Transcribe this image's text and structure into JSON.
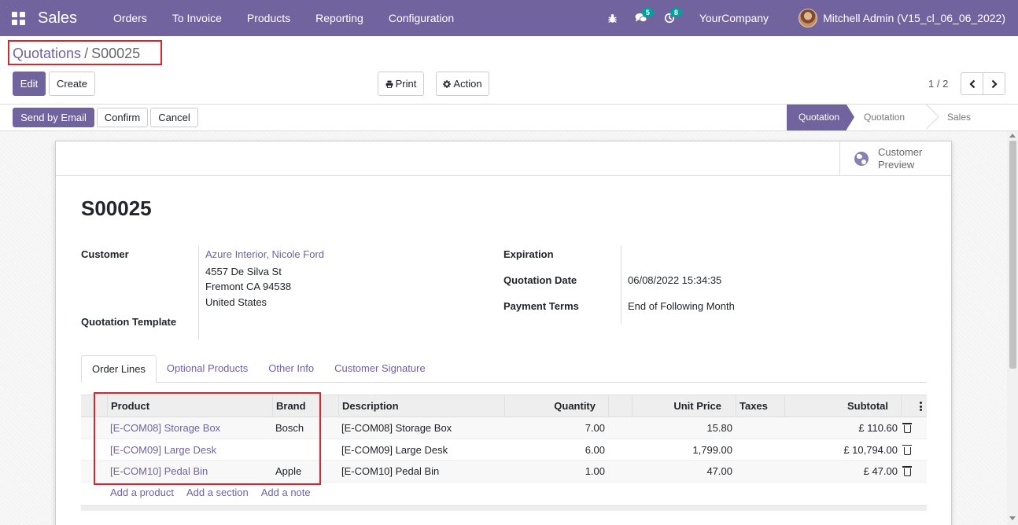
{
  "navbar": {
    "app_name": "Sales",
    "menu": [
      "Orders",
      "To Invoice",
      "Products",
      "Reporting",
      "Configuration"
    ],
    "messages_count": "5",
    "activities_count": "8",
    "company": "YourCompany",
    "user": "Mitchell Admin (V15_cl_06_06_2022)",
    "color": "#71639e"
  },
  "breadcrumb": {
    "parent": "Quotations",
    "separator": "/",
    "current": "S00025"
  },
  "control": {
    "edit": "Edit",
    "create": "Create",
    "print": "Print",
    "action": "Action",
    "pager": "1 / 2"
  },
  "statusbar": {
    "buttons": [
      "Send by Email",
      "Confirm",
      "Cancel"
    ],
    "steps": [
      "Quotation",
      "Quotation Sent",
      "Sales Order"
    ],
    "active_step": "Quotation"
  },
  "sheet": {
    "preview_label_1": "Customer",
    "preview_label_2": "Preview",
    "title": "S00025",
    "customer_label": "Customer",
    "customer_name": "Azure Interior, Nicole Ford",
    "address_1": "4557 De Silva St",
    "address_2": "Fremont CA 94538",
    "address_3": "United States",
    "template_label": "Quotation Template",
    "expiration_label": "Expiration",
    "quotation_date_label": "Quotation Date",
    "quotation_date": "06/08/2022 15:34:35",
    "payment_terms_label": "Payment Terms",
    "payment_terms": "End of Following Month"
  },
  "tabs": [
    "Order Lines",
    "Optional Products",
    "Other Info",
    "Customer Signature"
  ],
  "order_lines": {
    "headers": {
      "product": "Product",
      "brand": "Brand",
      "description": "Description",
      "quantity": "Quantity",
      "unit_price": "Unit Price",
      "taxes": "Taxes",
      "subtotal": "Subtotal"
    },
    "rows": [
      {
        "product": "[E-COM08] Storage Box",
        "brand": "Bosch",
        "description": "[E-COM08] Storage Box",
        "quantity": "7.00",
        "unit_price": "15.80",
        "subtotal": "£ 110.60"
      },
      {
        "product": "[E-COM09] Large Desk",
        "brand": "",
        "description": "[E-COM09] Large Desk",
        "quantity": "6.00",
        "unit_price": "1,799.00",
        "subtotal": "£ 10,794.00"
      },
      {
        "product": "[E-COM10] Pedal Bin",
        "brand": "Apple",
        "description": "[E-COM10] Pedal Bin",
        "quantity": "1.00",
        "unit_price": "47.00",
        "subtotal": "£ 47.00"
      }
    ],
    "add_product": "Add a product",
    "add_section": "Add a section",
    "add_note": "Add a note"
  }
}
